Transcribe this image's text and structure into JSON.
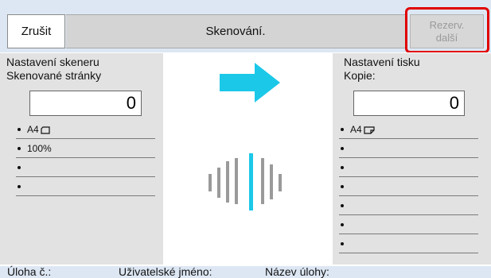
{
  "header": {
    "cancel_label": "Zrušit",
    "title": "Skenování.",
    "reserve_line1": "Rezerv.",
    "reserve_line2": "další"
  },
  "scanner": {
    "title_line1": "Nastavení skeneru",
    "title_line2": "Skenované stránky",
    "count": "0",
    "items": [
      "A4",
      "100%",
      "",
      ""
    ],
    "orientation_icon": "portrait-page-icon"
  },
  "print": {
    "title_line1": "Nastavení tisku",
    "title_line2": "Kopie:",
    "count": "0",
    "items": [
      "A4",
      "",
      "",
      "",
      "",
      "",
      ""
    ],
    "orientation_icon": "tray-page-icon"
  },
  "footer": {
    "job_no": "Úloha č.:",
    "user_name": "Uživatelské jméno:",
    "job_name": "Název úlohy:"
  },
  "colors": {
    "accent": "#1bc8e8",
    "highlight": "#e00000",
    "background": "#dde7f4"
  }
}
